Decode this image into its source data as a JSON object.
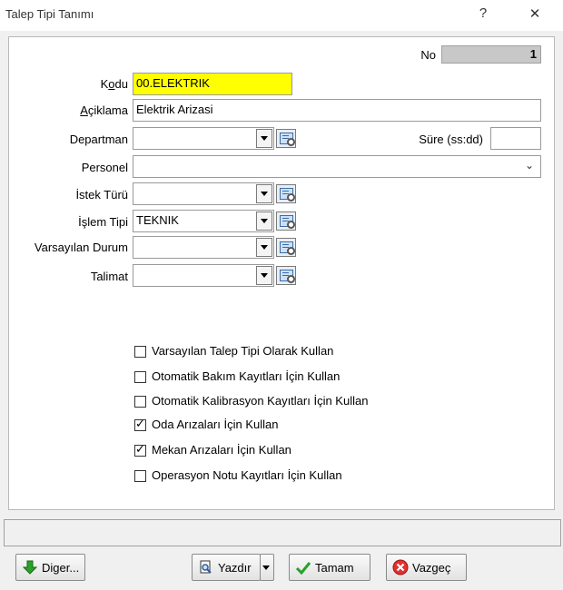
{
  "window": {
    "title": "Talep Tipi Tanımı",
    "help": "?",
    "close": "✕"
  },
  "no": {
    "label": "No",
    "value": "1"
  },
  "fields": {
    "kodu": {
      "label": "Kodu",
      "value": "00.ELEKTRIK"
    },
    "aciklama": {
      "label": "Açiklama",
      "value": "Elektrik Arizasi"
    },
    "departman": {
      "label": "Departman",
      "value": ""
    },
    "sure": {
      "label": "Süre (ss:dd)",
      "value": ""
    },
    "personel": {
      "label": "Personel",
      "value": ""
    },
    "istek_turu": {
      "label": "İstek Türü",
      "value": ""
    },
    "islem_tipi": {
      "label": "İşlem Tipi",
      "value": "TEKNIK"
    },
    "varsayilan_durum": {
      "label": "Varsayılan Durum",
      "value": ""
    },
    "talimat": {
      "label": "Talimat",
      "value": ""
    }
  },
  "checkboxes": [
    {
      "label": "Varsayılan Talep Tipi Olarak Kullan",
      "checked": false
    },
    {
      "label": "Otomatik Bakım Kayıtları İçin Kullan",
      "checked": false
    },
    {
      "label": "Otomatik Kalibrasyon Kayıtları İçin Kullan",
      "checked": false
    },
    {
      "label": "Oda Arızaları İçin Kullan",
      "checked": true
    },
    {
      "label": "Mekan Arızaları İçin Kullan",
      "checked": true
    },
    {
      "label": "Operasyon Notu Kayıtları İçin Kullan",
      "checked": false
    }
  ],
  "buttons": {
    "diger": "Diger...",
    "yazdir": "Yazdır",
    "tamam": "Tamam",
    "vazgec": "Vazgeç"
  },
  "colors": {
    "kodu_bg": "#ffff00",
    "no_bg": "#c8c8c8"
  }
}
